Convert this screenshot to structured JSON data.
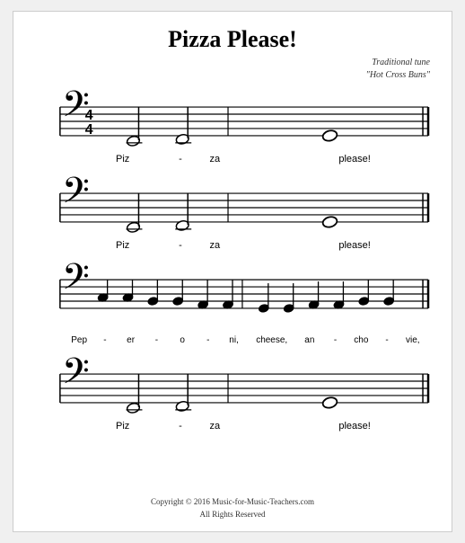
{
  "title": "Pizza Please!",
  "subtitle_line1": "Traditional tune",
  "subtitle_line2": "\"Hot Cross Buns\"",
  "sections": [
    {
      "id": "section1",
      "has_time_sig": true,
      "time_top": "4",
      "time_bottom": "4",
      "lyrics": [
        "Piz",
        "-",
        "za",
        "",
        "please!"
      ]
    },
    {
      "id": "section2",
      "has_time_sig": false,
      "lyrics": [
        "Piz",
        "-",
        "za",
        "",
        "please!"
      ]
    },
    {
      "id": "section3",
      "has_time_sig": false,
      "lyrics": [
        "Pep",
        "-",
        "er",
        "-",
        "o",
        "-",
        "ni,",
        "cheese,",
        "an",
        "-",
        "cho",
        "-",
        "vie,"
      ]
    },
    {
      "id": "section4",
      "has_time_sig": false,
      "lyrics": [
        "Piz",
        "-",
        "za",
        "",
        "please!"
      ]
    }
  ],
  "footer_line1": "Copyright © 2016  Music-for-Music-Teachers.com",
  "footer_line2": "All Rights Reserved"
}
